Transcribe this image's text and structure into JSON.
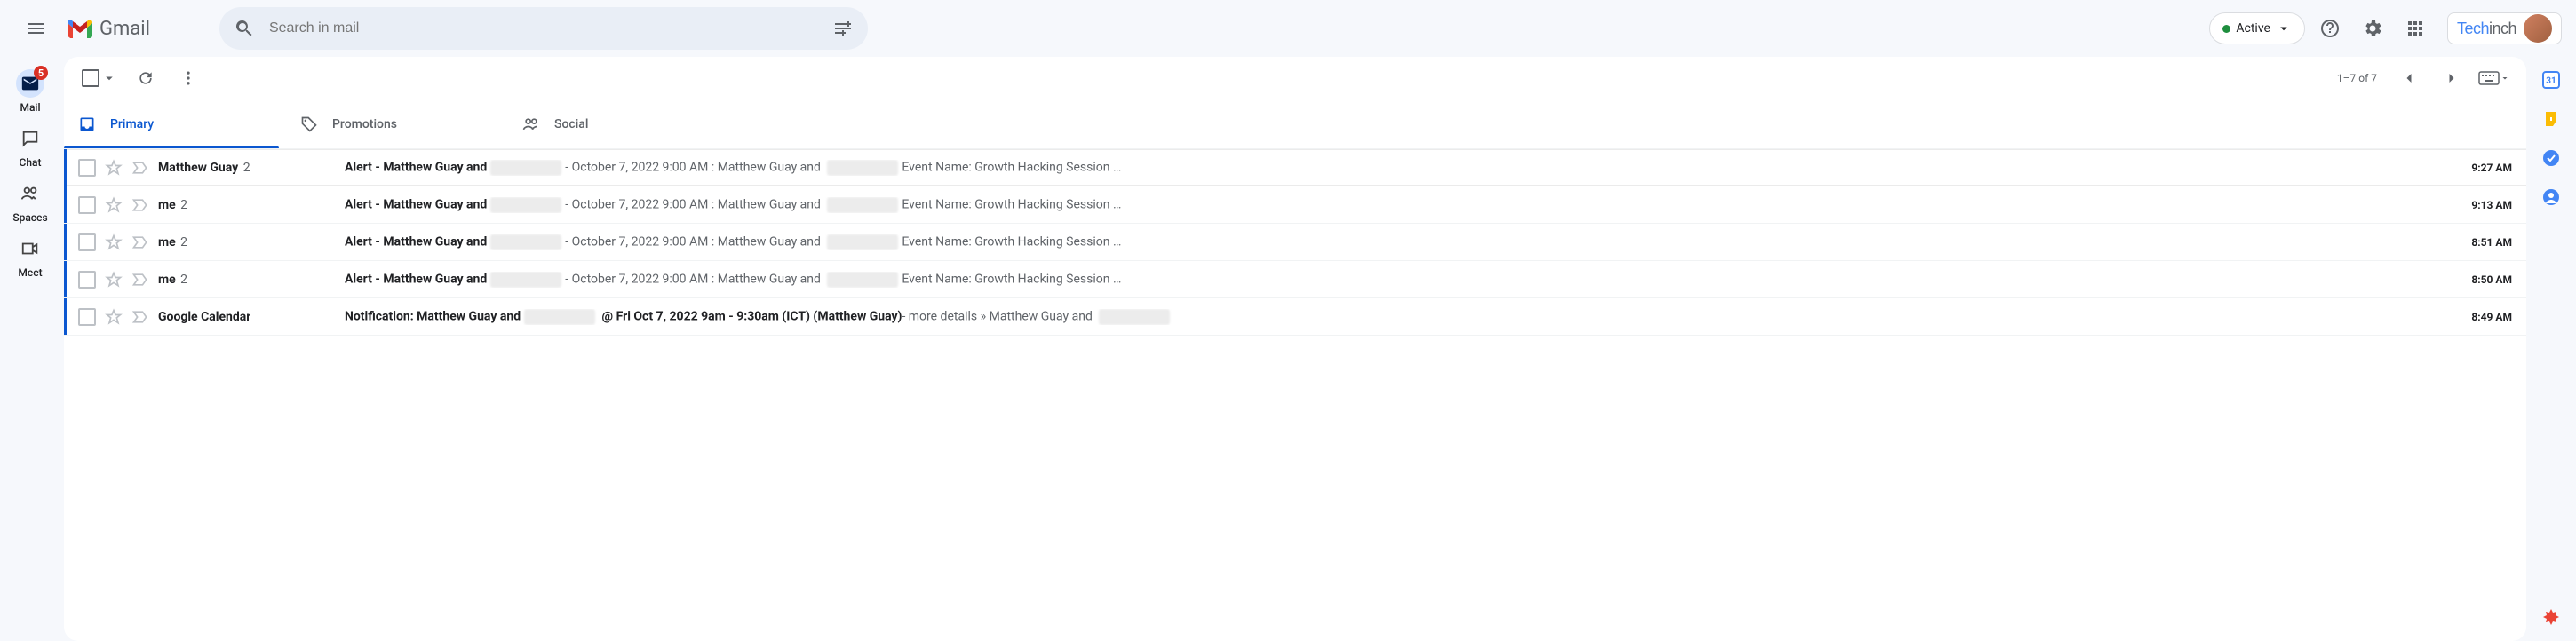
{
  "app": {
    "name": "Gmail",
    "search_placeholder": "Search in mail"
  },
  "status": {
    "label": "Active"
  },
  "workspace": {
    "brand_main": "Tech",
    "brand_sub": "inch"
  },
  "nav": {
    "items": [
      {
        "label": "Mail",
        "badge": "5"
      },
      {
        "label": "Chat"
      },
      {
        "label": "Spaces"
      },
      {
        "label": "Meet"
      }
    ]
  },
  "tabs": [
    {
      "label": "Primary"
    },
    {
      "label": "Promotions"
    },
    {
      "label": "Social"
    }
  ],
  "pagination": {
    "text": "1–7 of 7"
  },
  "emails": [
    {
      "sender": "Matthew Guay",
      "count": "2",
      "subject_a": "Alert - Matthew Guay and",
      "snippet_a": " - October 7, 2022 9:00 AM : Matthew Guay and ",
      "snippet_b": "Event Name: Growth Hacking Session …",
      "time": "9:27 AM",
      "unread": true,
      "type": "alert"
    },
    {
      "sender": "me",
      "count": "2",
      "subject_a": "Alert - Matthew Guay and",
      "snippet_a": " - October 7, 2022 9:00 AM : Matthew Guay and ",
      "snippet_b": "Event Name: Growth Hacking Session …",
      "time": "9:13 AM",
      "unread": true,
      "type": "alert"
    },
    {
      "sender": "me",
      "count": "2",
      "subject_a": "Alert - Matthew Guay and",
      "snippet_a": " - October 7, 2022 9:00 AM : Matthew Guay and ",
      "snippet_b": "Event Name: Growth Hacking Session …",
      "time": "8:51 AM",
      "unread": true,
      "type": "alert"
    },
    {
      "sender": "me",
      "count": "2",
      "subject_a": "Alert - Matthew Guay and",
      "snippet_a": " - October 7, 2022 9:00 AM : Matthew Guay and ",
      "snippet_b": "Event Name: Growth Hacking Session …",
      "time": "8:50 AM",
      "unread": true,
      "type": "alert"
    },
    {
      "sender": "Google Calendar",
      "count": "",
      "subject_a": "Notification: Matthew Guay and",
      "snippet_a": " @ Fri Oct 7, 2022 9am - 9:30am (ICT) (Matthew Guay)",
      "snippet_b": " - more details » Matthew Guay and",
      "time": "8:49 AM",
      "unread": true,
      "type": "notif"
    }
  ]
}
